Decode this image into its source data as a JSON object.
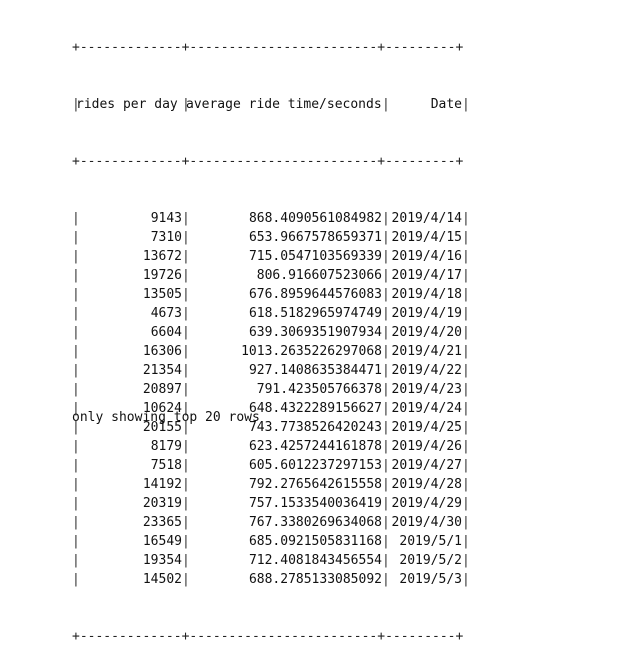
{
  "table": {
    "border_top": "+-------------+------------------------+---------+",
    "border_mid": "+-------------+------------------------+---------+",
    "border_bottom": "+-------------+------------------------+---------+",
    "headers": [
      "rides per day",
      "average ride time/seconds",
      "Date"
    ],
    "rows": [
      [
        "9143",
        "868.4090561084982",
        "2019/4/14"
      ],
      [
        "7310",
        "653.9667578659371",
        "2019/4/15"
      ],
      [
        "13672",
        "715.0547103569339",
        "2019/4/16"
      ],
      [
        "19726",
        "806.916607523066",
        "2019/4/17"
      ],
      [
        "13505",
        "676.8959644576083",
        "2019/4/18"
      ],
      [
        "4673",
        "618.5182965974749",
        "2019/4/19"
      ],
      [
        "6604",
        "639.3069351907934",
        "2019/4/20"
      ],
      [
        "16306",
        "1013.2635226297068",
        "2019/4/21"
      ],
      [
        "21354",
        "927.1408635384471",
        "2019/4/22"
      ],
      [
        "20897",
        "791.423505766378",
        "2019/4/23"
      ],
      [
        "10624",
        "648.4322289156627",
        "2019/4/24"
      ],
      [
        "20155",
        "743.7738526420243",
        "2019/4/25"
      ],
      [
        "8179",
        "623.4257244161878",
        "2019/4/26"
      ],
      [
        "7518",
        "605.6012237297153",
        "2019/4/27"
      ],
      [
        "14192",
        "792.2765642615558",
        "2019/4/28"
      ],
      [
        "20319",
        "757.1533540036419",
        "2019/4/29"
      ],
      [
        "23365",
        "767.3380269634068",
        "2019/4/30"
      ],
      [
        "16549",
        "685.0921505831168",
        "2019/5/1"
      ],
      [
        "19354",
        "712.4081843456554",
        "2019/5/2"
      ],
      [
        "14502",
        "688.2785133085092",
        "2019/5/3"
      ]
    ]
  },
  "footer": {
    "note": "only showing top 20 rows"
  }
}
